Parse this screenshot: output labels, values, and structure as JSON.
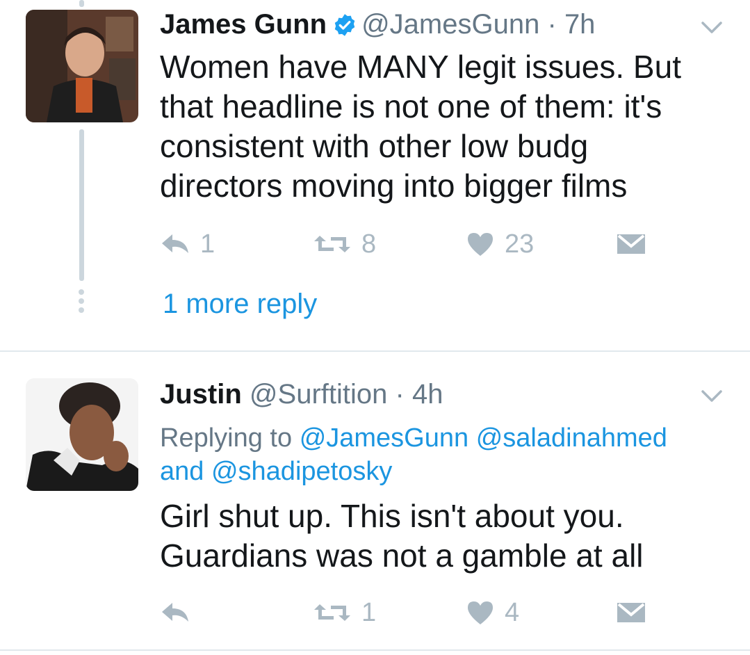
{
  "tweets": [
    {
      "name": "James Gunn",
      "handle": "@JamesGunn",
      "separator": "·",
      "time": "7h",
      "verified": true,
      "text": "Women have MANY legit issues. But\nthat headline is not one of them: it's\nconsistent with other low budg\ndirectors moving into bigger films",
      "actions": {
        "reply_count": "1",
        "retweet_count": "8",
        "like_count": "23"
      }
    },
    {
      "name": "Justin",
      "handle": "@Surftition",
      "separator": "·",
      "time": "4h",
      "verified": false,
      "replying_prefix": "Replying to",
      "replying_user1": "@JamesGunn",
      "replying_user2": "@saladinahmed",
      "replying_and": "and",
      "replying_user3": "@shadipetosky",
      "text": "Girl shut up. This isn't about you.\nGuardians was not a gamble at all",
      "actions": {
        "reply_count": "",
        "retweet_count": "1",
        "like_count": "4"
      }
    }
  ],
  "more_replies": "1 more reply",
  "colors": {
    "link": "#1b95e0",
    "muted": "#657786",
    "icon": "#aab8c2",
    "verified": "#1da1f2"
  },
  "icons": [
    "reply-icon",
    "retweet-icon",
    "heart-icon",
    "direct-message-icon",
    "chevron-down-icon",
    "verified-badge-icon"
  ]
}
